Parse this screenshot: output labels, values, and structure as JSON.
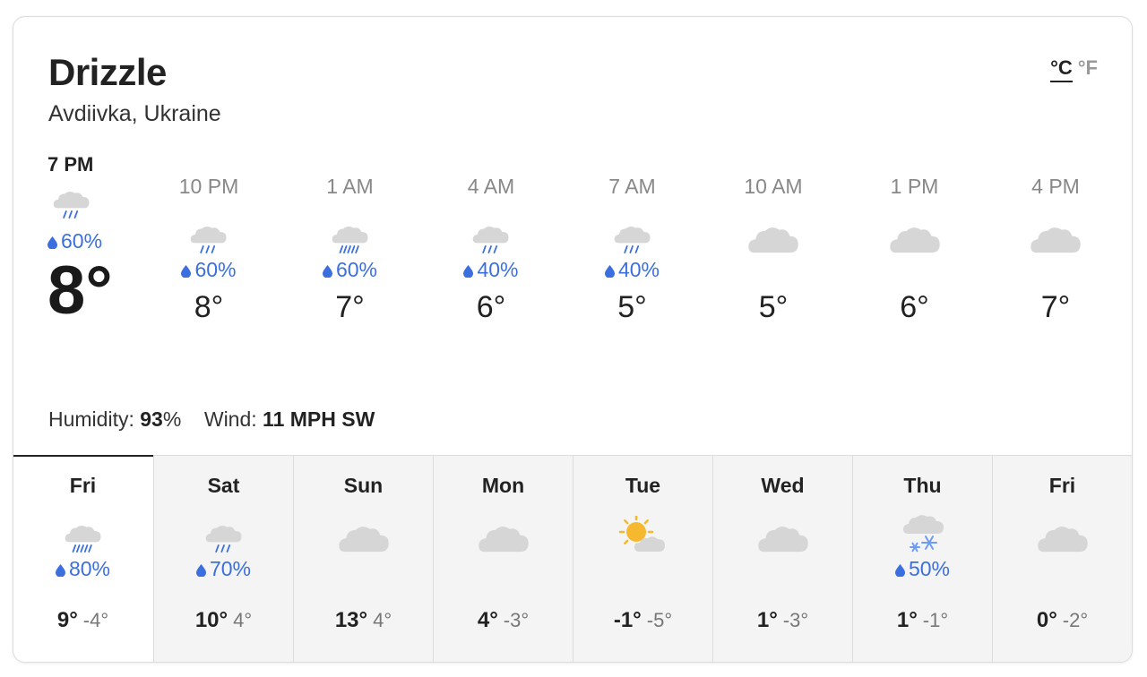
{
  "condition": "Drizzle",
  "location": "Avdiivka, Ukraine",
  "units": {
    "celsius": "°C",
    "fahrenheit": "°F",
    "selected": "celsius"
  },
  "current": {
    "time": "7 PM",
    "icon": "drizzle-icon",
    "precip": "60%",
    "temp": "8°"
  },
  "hourly": [
    {
      "time": "10 PM",
      "icon": "drizzle-icon",
      "precip": "60%",
      "temp": "8°"
    },
    {
      "time": "1 AM",
      "icon": "rain-icon",
      "precip": "60%",
      "temp": "7°"
    },
    {
      "time": "4 AM",
      "icon": "drizzle-icon",
      "precip": "40%",
      "temp": "6°"
    },
    {
      "time": "7 AM",
      "icon": "drizzle-icon",
      "precip": "40%",
      "temp": "5°"
    },
    {
      "time": "10 AM",
      "icon": "cloud-icon",
      "precip": "",
      "temp": "5°"
    },
    {
      "time": "1 PM",
      "icon": "cloud-icon",
      "precip": "",
      "temp": "6°"
    },
    {
      "time": "4 PM",
      "icon": "cloud-icon",
      "precip": "",
      "temp": "7°"
    }
  ],
  "details": {
    "humidity_label": "Humidity:",
    "humidity_value": "93",
    "humidity_unit": "%",
    "wind_label": "Wind:",
    "wind_value": "11 MPH SW"
  },
  "daily": [
    {
      "name": "Fri",
      "icon": "rain-icon",
      "precip": "80%",
      "hi": "9°",
      "lo": "-4°",
      "selected": true
    },
    {
      "name": "Sat",
      "icon": "drizzle-icon",
      "precip": "70%",
      "hi": "10°",
      "lo": "4°"
    },
    {
      "name": "Sun",
      "icon": "cloud-icon",
      "precip": "",
      "hi": "13°",
      "lo": "4°"
    },
    {
      "name": "Mon",
      "icon": "cloud-icon",
      "precip": "",
      "hi": "4°",
      "lo": "-3°"
    },
    {
      "name": "Tue",
      "icon": "sun-cloud-icon",
      "precip": "",
      "hi": "-1°",
      "lo": "-5°"
    },
    {
      "name": "Wed",
      "icon": "cloud-icon",
      "precip": "",
      "hi": "1°",
      "lo": "-3°"
    },
    {
      "name": "Thu",
      "icon": "snow-icon",
      "precip": "50%",
      "hi": "1°",
      "lo": "-1°"
    },
    {
      "name": "Fri",
      "icon": "cloud-icon",
      "precip": "",
      "hi": "0°",
      "lo": "-2°"
    }
  ],
  "colors": {
    "precip": "#3b6fe0",
    "cloud": "#d6d6d6",
    "sun": "#f5b82e",
    "snow": "#6e9cf2"
  }
}
